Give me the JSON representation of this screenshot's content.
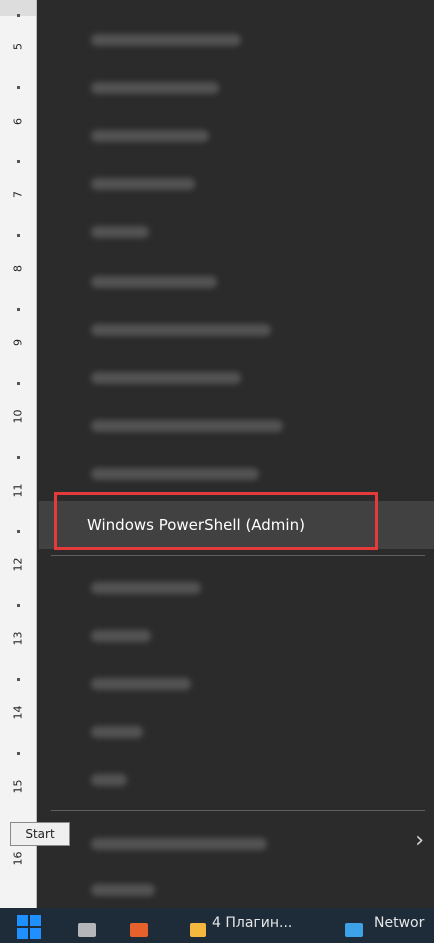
{
  "ruler": {
    "numbers": [
      "5",
      "6",
      "7",
      "8",
      "9",
      "10",
      "11",
      "12",
      "13",
      "14",
      "15",
      "16"
    ]
  },
  "menu": {
    "highlighted_item": "Windows PowerShell (Admin)",
    "more_chevron": "›"
  },
  "tooltip": {
    "text": "Start"
  },
  "taskbar": {
    "item1_text": "4 Плагин...",
    "item2_text": "Networ"
  },
  "colors": {
    "highlight_border": "#e53a3a",
    "menu_bg": "#2b2b2b",
    "accent_blue": "#1e90ff"
  }
}
